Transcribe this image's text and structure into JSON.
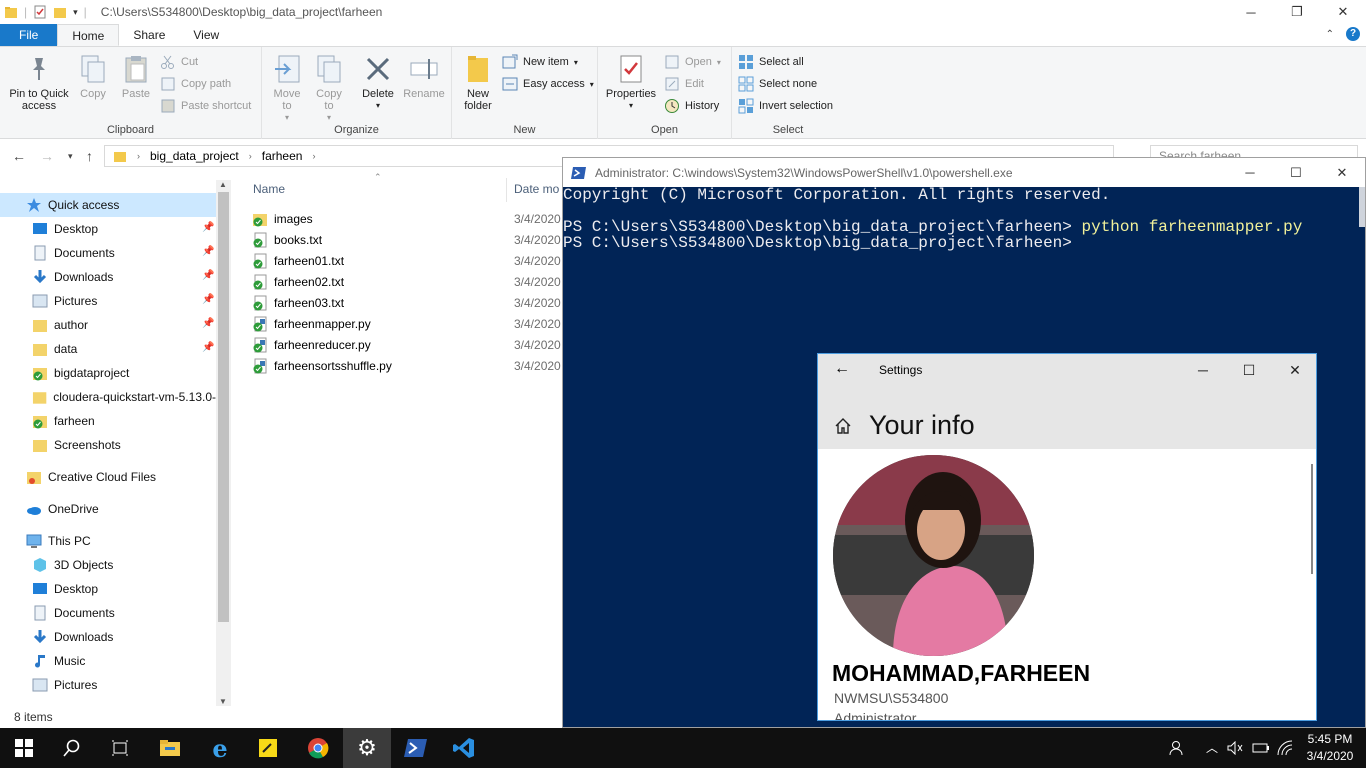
{
  "explorer": {
    "title_path": "C:\\Users\\S534800\\Desktop\\big_data_project\\farheen",
    "tabs": [
      "File",
      "Home",
      "Share",
      "View"
    ],
    "ribbon": {
      "clipboard": {
        "label": "Clipboard",
        "pin": [
          "Pin to Quick",
          "access"
        ],
        "copy": "Copy",
        "paste": "Paste",
        "cut": "Cut",
        "copy_path": "Copy path",
        "paste_shortcut": "Paste shortcut"
      },
      "organize": {
        "label": "Organize",
        "move_to": [
          "Move",
          "to"
        ],
        "copy_to": [
          "Copy",
          "to"
        ],
        "delete": "Delete",
        "rename": "Rename"
      },
      "new": {
        "label": "New",
        "new_folder": [
          "New",
          "folder"
        ],
        "new_item": "New item",
        "easy_access": "Easy access"
      },
      "open": {
        "label": "Open",
        "properties": "Properties",
        "open": "Open",
        "edit": "Edit",
        "history": "History"
      },
      "select": {
        "label": "Select",
        "select_all": "Select all",
        "select_none": "Select none",
        "invert": "Invert selection"
      }
    },
    "breadcrumb": [
      "big_data_project",
      "farheen"
    ],
    "search_placeholder": "Search farheen",
    "nav": {
      "quick_access": "Quick access",
      "quick_items": [
        "Desktop",
        "Documents",
        "Downloads",
        "Pictures",
        "author",
        "data",
        "bigdataproject",
        "cloudera-quickstart-vm-5.13.0-",
        "farheen",
        "Screenshots"
      ],
      "creative_cloud": "Creative Cloud Files",
      "onedrive": "OneDrive",
      "this_pc": "This PC",
      "pc_items": [
        "3D Objects",
        "Desktop",
        "Documents",
        "Downloads",
        "Music",
        "Pictures"
      ]
    },
    "columns": {
      "name": "Name",
      "date": "Date mo"
    },
    "files": [
      {
        "name": "images",
        "date": "3/4/2020"
      },
      {
        "name": "books.txt",
        "date": "3/4/2020"
      },
      {
        "name": "farheen01.txt",
        "date": "3/4/2020"
      },
      {
        "name": "farheen02.txt",
        "date": "3/4/2020"
      },
      {
        "name": "farheen03.txt",
        "date": "3/4/2020"
      },
      {
        "name": "farheenmapper.py",
        "date": "3/4/2020"
      },
      {
        "name": "farheenreducer.py",
        "date": "3/4/2020"
      },
      {
        "name": "farheensortsshuffle.py",
        "date": "3/4/2020"
      }
    ],
    "status": "8 items"
  },
  "powershell": {
    "title": "Administrator: C:\\windows\\System32\\WindowsPowerShell\\v1.0\\powershell.exe",
    "line1": "Copyright (C) Microsoft Corporation. All rights reserved.",
    "prompt": "PS C:\\Users\\S534800\\Desktop\\big_data_project\\farheen> ",
    "command": "python farheenmapper.py",
    "line3": "PS C:\\Users\\S534800\\Desktop\\big_data_project\\farheen>"
  },
  "settings": {
    "app_title": "Settings",
    "page_title": "Your info",
    "user_name": "MOHAMMAD,FARHEEN",
    "account": "NWMSU\\S534800",
    "role": "Administrator"
  },
  "taskbar": {
    "time": "5:45 PM",
    "date": "3/4/2020"
  },
  "colors": {
    "accent": "#1979ca",
    "powershell_bg": "#012456",
    "selection": "#cce8ff"
  }
}
